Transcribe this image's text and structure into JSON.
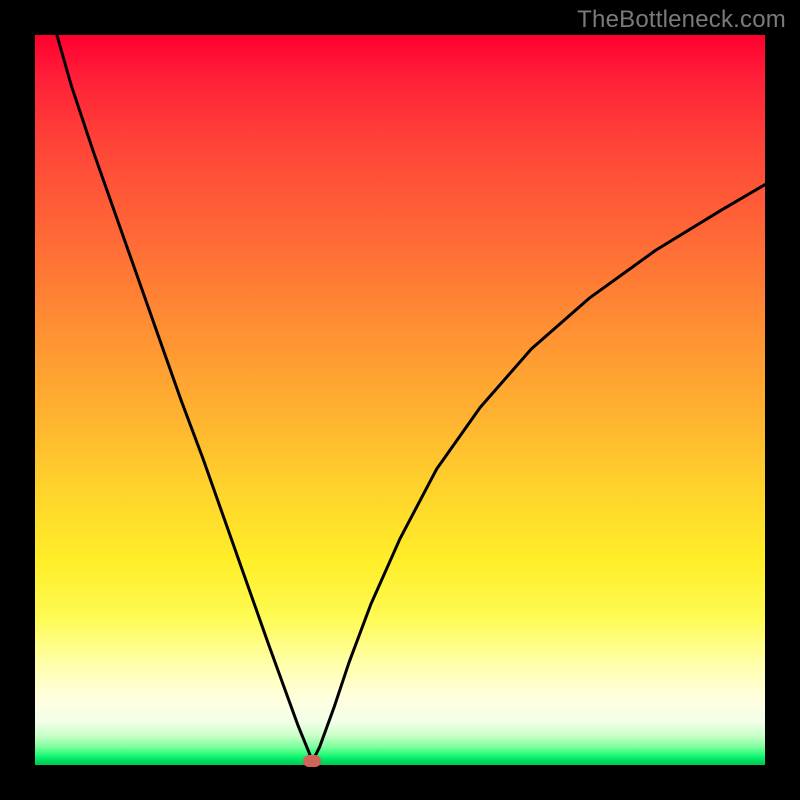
{
  "watermark": "TheBottleneck.com",
  "chart_data": {
    "type": "line",
    "title": "",
    "xlabel": "",
    "ylabel": "",
    "xlim": [
      0,
      100
    ],
    "ylim": [
      0,
      100
    ],
    "grid": false,
    "legend": false,
    "background_gradient": {
      "top_color": "#ff0030",
      "mid_color": "#ffee28",
      "bottom_color": "#00c74f"
    },
    "min_point": {
      "x": 38,
      "y": 0.5
    },
    "series": [
      {
        "name": "bottleneck-curve",
        "x": [
          3,
          5,
          8,
          11,
          14,
          17,
          20,
          23,
          26,
          29,
          32,
          34,
          36,
          37.5,
          38,
          39,
          41,
          43,
          46,
          50,
          55,
          61,
          68,
          76,
          85,
          94,
          100
        ],
        "y": [
          100,
          93,
          84,
          75.5,
          67,
          58.5,
          50,
          42,
          33.5,
          25,
          16.5,
          11,
          5.5,
          1.8,
          0.5,
          2.5,
          8,
          14,
          22,
          31,
          40.5,
          49,
          57,
          64,
          70.5,
          76,
          79.5
        ]
      }
    ],
    "marker": {
      "x": 38,
      "y": 0.5,
      "color": "#d0645a"
    }
  }
}
